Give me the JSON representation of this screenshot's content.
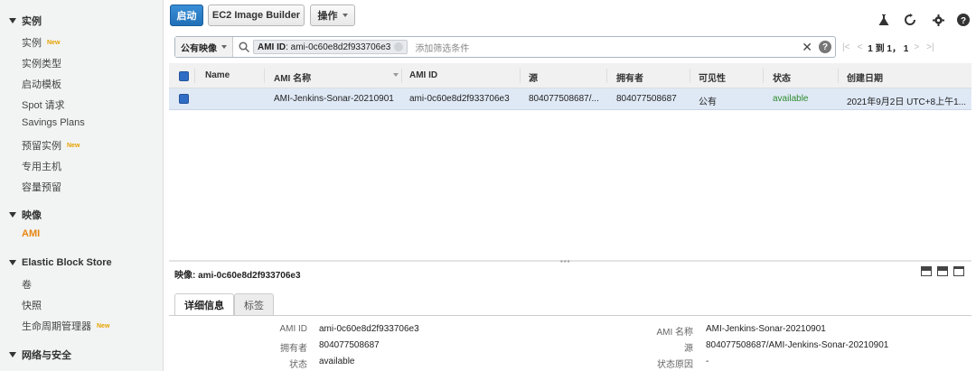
{
  "sidebar": {
    "sections": [
      {
        "label": "实例",
        "items": [
          {
            "label": "实例",
            "new": "New"
          },
          {
            "label": "实例类型",
            "new": ""
          },
          {
            "label": "启动模板",
            "new": ""
          },
          {
            "label": "Spot 请求",
            "new": ""
          },
          {
            "label": "Savings Plans",
            "new": ""
          },
          {
            "label": "预留实例",
            "new": "New"
          },
          {
            "label": "专用主机",
            "new": ""
          },
          {
            "label": "容量预留",
            "new": ""
          }
        ]
      },
      {
        "label": "映像",
        "items": [
          {
            "label": "AMI",
            "new": ""
          }
        ]
      },
      {
        "label": "Elastic Block Store",
        "items": [
          {
            "label": "卷",
            "new": ""
          },
          {
            "label": "快照",
            "new": ""
          },
          {
            "label": "生命周期管理器",
            "new": "New"
          }
        ]
      },
      {
        "label": "网络与安全",
        "items": []
      }
    ]
  },
  "toolbar": {
    "launch_label": "启动",
    "image_builder_label": "EC2 Image Builder",
    "actions_label": "操作",
    "icons": [
      "flask-icon",
      "refresh-icon",
      "gear-icon",
      "help-icon"
    ]
  },
  "filter": {
    "dropdown_label": "公有映像",
    "chip_key": "AMI ID",
    "chip_value": ": ami-0c60e8d2f933706e3",
    "placeholder": "添加筛选条件"
  },
  "pager": {
    "text": "1 到 1， 1"
  },
  "table": {
    "columns": [
      "Name",
      "AMI 名称",
      "AMI ID",
      "源",
      "拥有者",
      "可见性",
      "状态",
      "创建日期"
    ],
    "rows": [
      {
        "name": "",
        "ami_name": "AMI-Jenkins-Sonar-20210901",
        "ami_id": "ami-0c60e8d2f933706e3",
        "source": "804077508687/...",
        "owner": "804077508687",
        "visibility": "公有",
        "status": "available",
        "created": "2021年9月2日 UTC+8上午1..."
      }
    ]
  },
  "detail": {
    "title": "映像: ami-0c60e8d2f933706e3",
    "tabs": [
      "详细信息",
      "标签"
    ],
    "left": [
      {
        "label": "AMI ID",
        "value": "ami-0c60e8d2f933706e3"
      },
      {
        "label": "拥有者",
        "value": "804077508687"
      },
      {
        "label": "状态",
        "value": "available"
      }
    ],
    "right": [
      {
        "label": "AMI 名称",
        "value": "AMI-Jenkins-Sonar-20210901"
      },
      {
        "label": "源",
        "value": "804077508687/AMI-Jenkins-Sonar-20210901"
      },
      {
        "label": "状态原因",
        "value": "-"
      }
    ]
  },
  "colors": {
    "primary": "#1f6fb8",
    "status_available": "#2e8b2e",
    "active_nav": "#e6860e",
    "new_badge": "#e6a300"
  }
}
